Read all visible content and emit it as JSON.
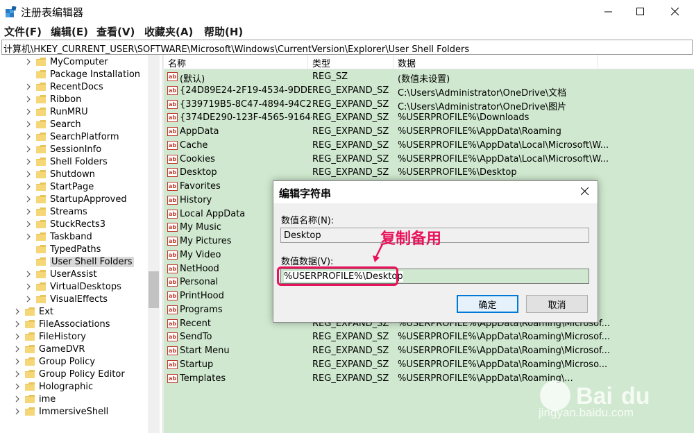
{
  "window": {
    "title": "注册表编辑器"
  },
  "menu": [
    "文件(F)",
    "编辑(E)",
    "查看(V)",
    "收藏夹(A)",
    "帮助(H)"
  ],
  "address": "计算机\\HKEY_CURRENT_USER\\SOFTWARE\\Microsoft\\Windows\\CurrentVersion\\Explorer\\User Shell Folders",
  "tree": {
    "items": [
      {
        "label": "MyComputer",
        "expandable": true
      },
      {
        "label": "Package Installation",
        "expandable": false
      },
      {
        "label": "RecentDocs",
        "expandable": true
      },
      {
        "label": "Ribbon",
        "expandable": true
      },
      {
        "label": "RunMRU",
        "expandable": true
      },
      {
        "label": "Search",
        "expandable": true
      },
      {
        "label": "SearchPlatform",
        "expandable": true
      },
      {
        "label": "SessionInfo",
        "expandable": true
      },
      {
        "label": "Shell Folders",
        "expandable": true
      },
      {
        "label": "Shutdown",
        "expandable": true
      },
      {
        "label": "StartPage",
        "expandable": true
      },
      {
        "label": "StartupApproved",
        "expandable": true
      },
      {
        "label": "Streams",
        "expandable": true
      },
      {
        "label": "StuckRects3",
        "expandable": true
      },
      {
        "label": "Taskband",
        "expandable": true
      },
      {
        "label": "TypedPaths",
        "expandable": false
      },
      {
        "label": "User Shell Folders",
        "expandable": false,
        "selected": true
      },
      {
        "label": "UserAssist",
        "expandable": true
      },
      {
        "label": "VirtualDesktops",
        "expandable": true
      },
      {
        "label": "VisualEffects",
        "expandable": true
      }
    ],
    "parent_items": [
      "Ext",
      "FileAssociations",
      "FileHistory",
      "GameDVR",
      "Group Policy",
      "Group Policy Editor",
      "Holographic",
      "ime",
      "ImmersiveShell"
    ]
  },
  "list": {
    "columns": [
      "名称",
      "类型",
      "数据"
    ],
    "rows": [
      {
        "name": "(默认)",
        "type": "REG_SZ",
        "data": "(数值未设置)"
      },
      {
        "name": "{24D89E24-2F19-4534-9DDE-...",
        "type": "REG_EXPAND_SZ",
        "data": "C:\\Users\\Administrator\\OneDrive\\文档"
      },
      {
        "name": "{339719B5-8C47-4894-94C2-...",
        "type": "REG_EXPAND_SZ",
        "data": "C:\\Users\\Administrator\\OneDrive\\图片"
      },
      {
        "name": "{374DE290-123F-4565-9164-...",
        "type": "REG_EXPAND_SZ",
        "data": "%USERPROFILE%\\Downloads"
      },
      {
        "name": "AppData",
        "type": "REG_EXPAND_SZ",
        "data": "%USERPROFILE%\\AppData\\Roaming"
      },
      {
        "name": "Cache",
        "type": "REG_EXPAND_SZ",
        "data": "%USERPROFILE%\\AppData\\Local\\Microsoft\\W..."
      },
      {
        "name": "Cookies",
        "type": "REG_EXPAND_SZ",
        "data": "%USERPROFILE%\\AppData\\Local\\Microsoft\\W..."
      },
      {
        "name": "Desktop",
        "type": "REG_EXPAND_SZ",
        "data": "%USERPROFILE%\\Desktop"
      },
      {
        "name": "Favorites",
        "type": "",
        "data": ""
      },
      {
        "name": "History",
        "type": "",
        "data": ""
      },
      {
        "name": "Local AppData",
        "type": "",
        "data": ""
      },
      {
        "name": "My Music",
        "type": "",
        "data": ""
      },
      {
        "name": "My Pictures",
        "type": "",
        "data": ""
      },
      {
        "name": "My Video",
        "type": "",
        "data": ""
      },
      {
        "name": "NetHood",
        "type": "",
        "data": ""
      },
      {
        "name": "Personal",
        "type": "",
        "data": ""
      },
      {
        "name": "PrintHood",
        "type": "",
        "data": ""
      },
      {
        "name": "Programs",
        "type": "",
        "data": ""
      },
      {
        "name": "Recent",
        "type": "REG_EXPAND_SZ",
        "data": "%USERPROFILE%\\AppData\\Roaming\\Microsof..."
      },
      {
        "name": "SendTo",
        "type": "REG_EXPAND_SZ",
        "data": "%USERPROFILE%\\AppData\\Roaming\\Microsof..."
      },
      {
        "name": "Start Menu",
        "type": "REG_EXPAND_SZ",
        "data": "%USERPROFILE%\\AppData\\Roaming\\Microsof..."
      },
      {
        "name": "Startup",
        "type": "REG_EXPAND_SZ",
        "data": "%USERPROFILE%\\AppData\\Roaming\\Microso..."
      },
      {
        "name": "Templates",
        "type": "REG_EXPAND_SZ",
        "data": "%USERPROFILE%\\AppData\\Roaming\\..."
      }
    ]
  },
  "dialog": {
    "title": "编辑字符串",
    "name_label": "数值名称(N):",
    "name_value": "Desktop",
    "data_label": "数值数据(V):",
    "data_value": "%USERPROFILE%\\Desktop",
    "ok_label": "确定",
    "cancel_label": "取消"
  },
  "annotation": {
    "text": "复制备用",
    "color": "#e8135a"
  },
  "watermark": {
    "text": "jingyan.baidu.com"
  },
  "colors": {
    "list_bg": "#cfe8cf",
    "accent": "#0078d7"
  }
}
